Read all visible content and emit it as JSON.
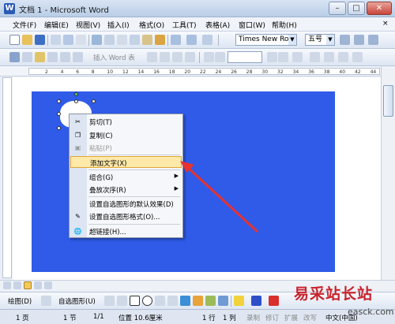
{
  "window": {
    "title": "文档 1 - Microsoft Word",
    "app_icon_letter": "W",
    "minimize": "–",
    "maximize": "□",
    "close": "✕"
  },
  "menubar": [
    "文件(F)",
    "编辑(E)",
    "视图(V)",
    "插入(I)",
    "格式(O)",
    "工具(T)",
    "表格(A)",
    "窗口(W)",
    "帮助(H)"
  ],
  "menu_close": "×",
  "formatting": {
    "font": "Times New Roman",
    "size": "五号"
  },
  "toolbar2": {
    "insert_word": "插入 Word 表"
  },
  "ruler": [
    "2",
    "4",
    "6",
    "8",
    "10",
    "12",
    "14",
    "16",
    "18",
    "20",
    "22",
    "24",
    "26",
    "28",
    "30",
    "32",
    "34",
    "36",
    "38",
    "40",
    "42",
    "44"
  ],
  "context_menu": {
    "items": [
      {
        "label": "剪切(T)",
        "icon": "scissors-icon",
        "glyph": "✂",
        "disabled": false,
        "highlighted": false
      },
      {
        "label": "复制(C)",
        "icon": "copy-icon",
        "glyph": "❐",
        "disabled": false,
        "highlighted": false
      },
      {
        "label": "粘贴(P)",
        "icon": "paste-icon",
        "glyph": "▣",
        "disabled": true,
        "highlighted": false
      },
      {
        "label": "添加文字(X)",
        "icon": "",
        "glyph": "",
        "disabled": false,
        "highlighted": true
      },
      {
        "label": "组合(G)",
        "icon": "",
        "glyph": "",
        "disabled": false,
        "highlighted": false,
        "submenu": true
      },
      {
        "label": "叠放次序(R)",
        "icon": "",
        "glyph": "",
        "disabled": false,
        "highlighted": false,
        "submenu": true
      },
      {
        "label": "设置自选图形的默认效果(D)",
        "icon": "",
        "glyph": "",
        "disabled": false,
        "highlighted": false
      },
      {
        "label": "设置自选图形格式(O)...",
        "icon": "format-shape-icon",
        "glyph": "✎",
        "disabled": false,
        "highlighted": false
      },
      {
        "label": "超链接(H)...",
        "icon": "hyperlink-icon",
        "glyph": "🌐",
        "disabled": false,
        "highlighted": false
      }
    ],
    "submenu_glyph": "▶"
  },
  "drawing_toolbar": {
    "draw": "绘图(D)",
    "autoshapes": "自选图形(U)"
  },
  "status_bar": {
    "page": "1 页",
    "section": "1 节",
    "pages": "1/1",
    "position": "位置 10.6厘米",
    "line": "1 行",
    "column": "1 列",
    "rec": "录制",
    "trk": "修订",
    "ext": "扩展",
    "ovr": "改写",
    "lang": "中文(中国)"
  },
  "watermark": {
    "cn": "易采站长站",
    "en": "easck.com"
  },
  "colors": {
    "canvas_blue": "#2f5be8",
    "highlight": "#ffe9a8",
    "arrow_red": "#e53232"
  }
}
